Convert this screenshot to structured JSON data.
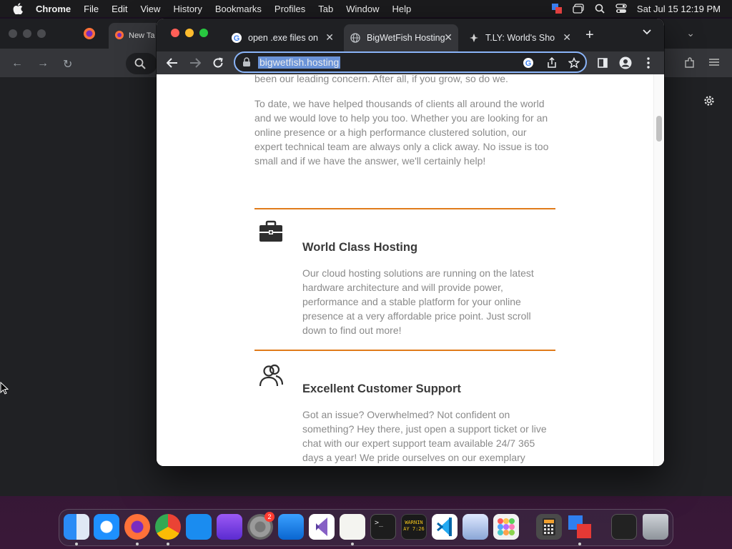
{
  "menubar": {
    "app": "Chrome",
    "items": [
      "File",
      "Edit",
      "View",
      "History",
      "Bookmarks",
      "Profiles",
      "Tab",
      "Window",
      "Help"
    ],
    "datetime": "Sat Jul 15  12:19 PM"
  },
  "background_window": {
    "tab_title": "New Ta"
  },
  "browser": {
    "tabs": [
      {
        "title": "open .exe files on",
        "icon": "google-icon"
      },
      {
        "title": "BigWetFish Hosting",
        "icon": "globe-icon"
      },
      {
        "title": "T.LY: World's Sho",
        "icon": "tly-icon"
      }
    ],
    "url": "bigwetfish.hosting"
  },
  "page": {
    "intro_tail": "been our leading concern. After all, if you grow, so do we.",
    "intro_para": "To date, we have helped thousands of clients all around the world and we would love to help you too. Whether you are looking for an online presence or a high performance clustered solution, our expert technical team are always only a click away. No issue is too small and if we have the answer, we'll certainly help!",
    "features": [
      {
        "title": "World Class Hosting",
        "icon": "briefcase-icon",
        "text": "Our cloud hosting solutions are running on the latest hardware architecture and will provide power, performance and a stable platform for your online presence at a very affordable price point. Just scroll down to find out more!"
      },
      {
        "title": "Excellent Customer Support",
        "icon": "users-icon",
        "text": "Got an issue? Overwhelmed? Not confident on something? Hey there, just open a support ticket or live chat with our expert support team available 24/7 365 days a year! We pride ourselves on our exemplary customer service. You can be certain that"
      }
    ]
  },
  "dock": {
    "badge_count": "2",
    "warning_widget_text": "WARNIN",
    "warning_widget_time": "AY 7:26"
  },
  "colors": {
    "accent_orange": "#e07b1a",
    "omnibox_focus": "#8ab4f8"
  }
}
